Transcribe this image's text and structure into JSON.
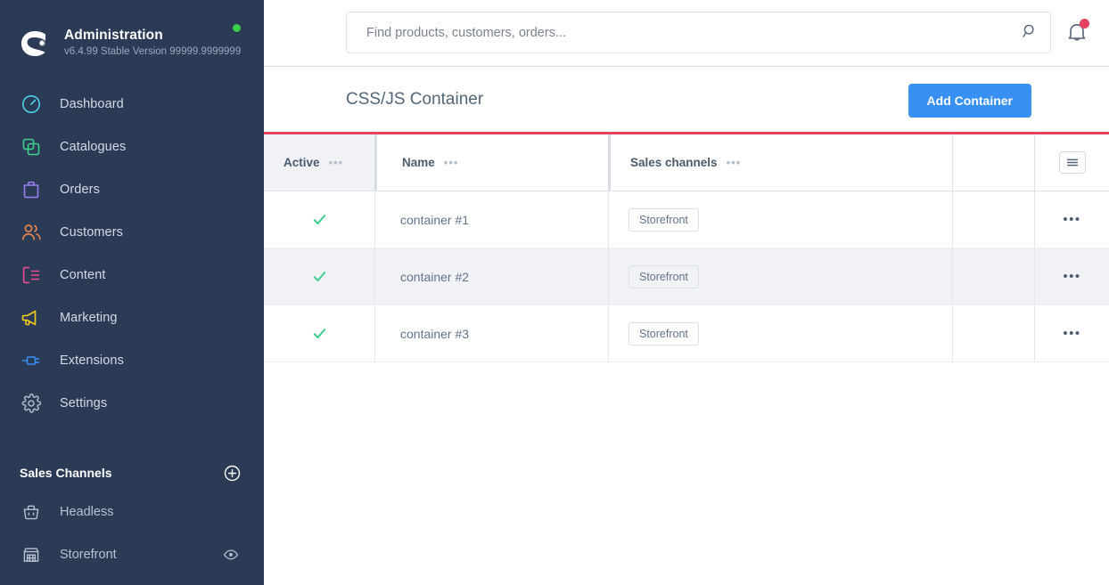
{
  "sidebar": {
    "brand": {
      "title": "Administration",
      "version": "v6.4.99 Stable Version 99999.9999999",
      "logo_icon": "shopware-logo-icon",
      "status_icon": "status-online-dot"
    },
    "nav": [
      {
        "label": "Dashboard",
        "icon": "dashboard-icon",
        "color": "#4dd2e8"
      },
      {
        "label": "Catalogues",
        "icon": "catalogues-icon",
        "color": "#3ecf8e"
      },
      {
        "label": "Orders",
        "icon": "orders-icon",
        "color": "#9b7cf0"
      },
      {
        "label": "Customers",
        "icon": "customers-icon",
        "color": "#f08a4b"
      },
      {
        "label": "Content",
        "icon": "content-icon",
        "color": "#f04b8e"
      },
      {
        "label": "Marketing",
        "icon": "marketing-icon",
        "color": "#f0cc1e"
      },
      {
        "label": "Extensions",
        "icon": "extensions-icon",
        "color": "#3890f5"
      },
      {
        "label": "Settings",
        "icon": "settings-gear-icon",
        "color": "#aab4c4"
      }
    ],
    "sales_channels": {
      "title": "Sales Channels",
      "add_icon": "plus-circle-icon",
      "items": [
        {
          "label": "Headless",
          "icon": "basket-icon",
          "action_icon": null
        },
        {
          "label": "Storefront",
          "icon": "store-icon",
          "action_icon": "eye-icon"
        }
      ]
    }
  },
  "topbar": {
    "search": {
      "placeholder": "Find products, customers, orders...",
      "value": "",
      "icon": "search-icon"
    },
    "notifications": {
      "icon": "bell-icon",
      "has_unread": true,
      "badge_color": "#e4435f"
    }
  },
  "page": {
    "title": "CSS/JS Container",
    "add_button_label": "Add Container",
    "accent_color": "#3890f5",
    "divider_color": "#e4435f"
  },
  "table": {
    "columns": [
      {
        "label": "Active",
        "menu_icon": "column-menu-icon"
      },
      {
        "label": "Name",
        "menu_icon": "column-menu-icon"
      },
      {
        "label": "Sales channels",
        "menu_icon": "column-menu-icon"
      }
    ],
    "settings_icon": "list-settings-icon",
    "row_menu_icon": "row-context-menu-icon",
    "active_icon": "checkmark-icon",
    "active_color": "#3ecf8e",
    "rows": [
      {
        "active": true,
        "name": "container #1",
        "sales_channel": "Storefront"
      },
      {
        "active": true,
        "name": "container #2",
        "sales_channel": "Storefront"
      },
      {
        "active": true,
        "name": "container #3",
        "sales_channel": "Storefront"
      }
    ]
  }
}
